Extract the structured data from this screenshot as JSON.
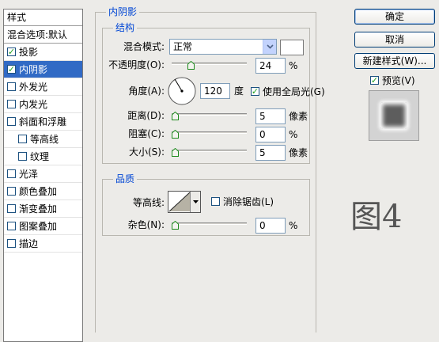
{
  "sidebar": {
    "header": "样式",
    "blend_default": "混合选项:默认",
    "items": [
      {
        "label": "投影",
        "checked": true,
        "active": false,
        "indent": false
      },
      {
        "label": "内阴影",
        "checked": true,
        "active": true,
        "indent": false
      },
      {
        "label": "外发光",
        "checked": false,
        "active": false,
        "indent": false
      },
      {
        "label": "内发光",
        "checked": false,
        "active": false,
        "indent": false
      },
      {
        "label": "斜面和浮雕",
        "checked": false,
        "active": false,
        "indent": false
      },
      {
        "label": "等高线",
        "checked": false,
        "active": false,
        "indent": true
      },
      {
        "label": "纹理",
        "checked": false,
        "active": false,
        "indent": true
      },
      {
        "label": "光泽",
        "checked": false,
        "active": false,
        "indent": false
      },
      {
        "label": "颜色叠加",
        "checked": false,
        "active": false,
        "indent": false
      },
      {
        "label": "渐变叠加",
        "checked": false,
        "active": false,
        "indent": false
      },
      {
        "label": "图案叠加",
        "checked": false,
        "active": false,
        "indent": false
      },
      {
        "label": "描边",
        "checked": false,
        "active": false,
        "indent": false
      }
    ]
  },
  "inner_shadow": {
    "title": "内阴影",
    "structure": {
      "title": "结构",
      "blend_mode_label": "混合模式:",
      "blend_mode_value": "正常",
      "shadow_color": "#ffffff",
      "opacity_label": "不透明度(O):",
      "opacity_value": "24",
      "opacity_fraction": 0.24,
      "opacity_unit": "%",
      "angle_label": "角度(A):",
      "angle_value": "120",
      "angle_unit": "度",
      "global_light_label": "使用全局光(G)",
      "global_light_checked": true,
      "distance_label": "距离(D):",
      "distance_value": "5",
      "distance_unit": "像素",
      "choke_label": "阻塞(C):",
      "choke_value": "0",
      "choke_unit": "%",
      "size_label": "大小(S):",
      "size_value": "5",
      "size_unit": "像素"
    },
    "quality": {
      "title": "品质",
      "contour_label": "等高线:",
      "antialias_label": "消除锯齿(L)",
      "antialias_checked": false,
      "noise_label": "杂色(N):",
      "noise_value": "0",
      "noise_unit": "%"
    }
  },
  "buttons": {
    "ok": "确定",
    "cancel": "取消",
    "new_style": "新建样式(W)...",
    "preview_label": "预览(V)",
    "preview_checked": true
  },
  "watermark": "图4",
  "colors": {
    "selection": "#316ac5",
    "group_title": "#0046d5",
    "check": "#21a121"
  }
}
